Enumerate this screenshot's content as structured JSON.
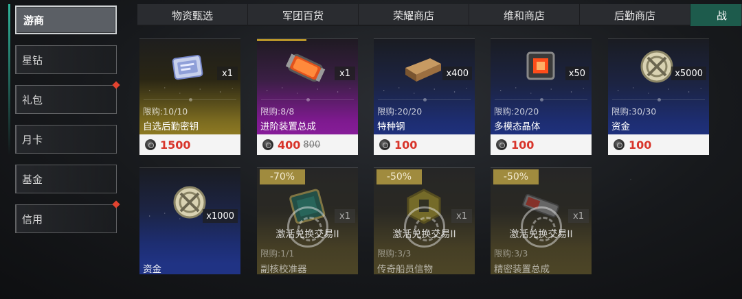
{
  "sidebar": {
    "items": [
      {
        "label": "游商",
        "active": true,
        "badge": false
      },
      {
        "label": "星钻",
        "active": false,
        "badge": false
      },
      {
        "label": "礼包",
        "active": false,
        "badge": true
      },
      {
        "label": "月卡",
        "active": false,
        "badge": false
      },
      {
        "label": "基金",
        "active": false,
        "badge": false
      },
      {
        "label": "信用",
        "active": false,
        "badge": true
      }
    ]
  },
  "tabs": [
    {
      "label": "物资甄选"
    },
    {
      "label": "军团百货"
    },
    {
      "label": "荣耀商店"
    },
    {
      "label": "维和商店"
    },
    {
      "label": "后勤商店"
    },
    {
      "label": "战"
    }
  ],
  "shop": {
    "cards": [
      {
        "qty": "x1",
        "limit": "限购:10/10",
        "name": "自选后勤密钥",
        "price": "1500",
        "old_price": "",
        "theme": "gold",
        "icon": "key-card-icon"
      },
      {
        "qty": "x1",
        "limit": "限购:8/8",
        "name": "进阶装置总成",
        "price": "400",
        "old_price": "800",
        "theme": "purple",
        "icon": "device-capsule-icon"
      },
      {
        "qty": "x400",
        "limit": "限购:20/20",
        "name": "特种钢",
        "price": "100",
        "old_price": "",
        "theme": "blue",
        "icon": "steel-ingot-icon"
      },
      {
        "qty": "x50",
        "limit": "限购:20/20",
        "name": "多模态晶体",
        "price": "100",
        "old_price": "",
        "theme": "blue",
        "icon": "crystal-cube-icon"
      },
      {
        "qty": "x5000",
        "limit": "限购:30/30",
        "name": "资金",
        "price": "100",
        "old_price": "",
        "theme": "blue",
        "icon": "fund-coin-icon"
      },
      {
        "qty": "x1000",
        "limit": "",
        "name": "资金",
        "price": "",
        "old_price": "",
        "theme": "blue",
        "icon": "fund-coin-icon"
      },
      {
        "qty": "x1",
        "limit": "限购:1/1",
        "name": "副核校准器",
        "discount": "-70%",
        "lock_text": "激活兑换交易II",
        "theme": "locked",
        "icon": "calibrator-icon"
      },
      {
        "qty": "x1",
        "limit": "限购:3/3",
        "name": "传奇船员信物",
        "discount": "-50%",
        "lock_text": "激活兑换交易II",
        "theme": "locked",
        "icon": "token-icon"
      },
      {
        "qty": "x1",
        "limit": "限购:3/3",
        "name": "精密装置总成",
        "discount": "-50%",
        "lock_text": "激活兑换交易II",
        "theme": "locked",
        "icon": "precision-device-icon"
      }
    ]
  },
  "colors": {
    "accent": "#2fb49b",
    "price": "#d8342a",
    "badge": "#e2432f"
  }
}
